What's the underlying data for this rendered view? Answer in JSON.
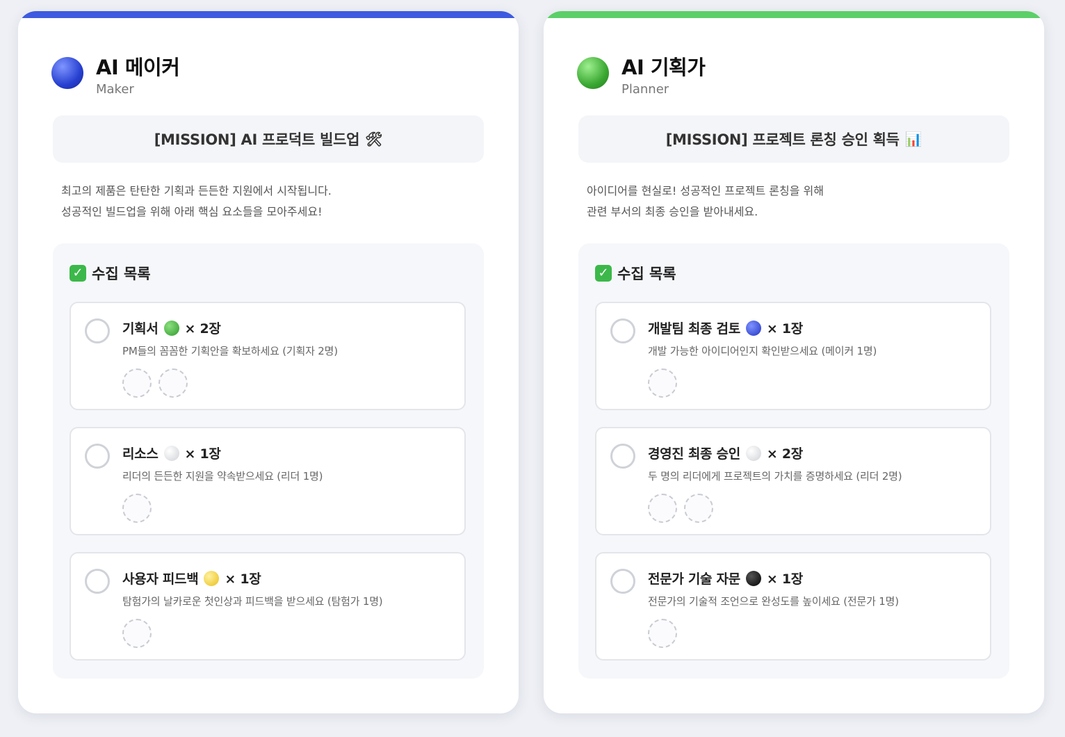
{
  "cards": [
    {
      "accent": "#3d5ae0",
      "orb_color": "#2740d0",
      "title": "AI 메이커",
      "subtitle": "Maker",
      "mission": "[MISSION] AI 프로덕트 빌드업",
      "mission_icon": "hammer-wrench-icon",
      "mission_glyph": "🛠",
      "desc_line1": "최고의 제품은 탄탄한 기획과 든든한 지원에서 시작됩니다.",
      "desc_line2": "성공적인 빌드업을 위해 아래 핵심 요소들을 모아주세요!",
      "collect_title": "수집 목록",
      "items": [
        {
          "name": "기획서",
          "dot": "green",
          "count": "× 2장",
          "desc": "PM들의 꼼꼼한 기획안을 확보하세요 (기획자 2명)",
          "slots": 2
        },
        {
          "name": "리소스",
          "dot": "white",
          "count": "× 1장",
          "desc": "리더의 든든한 지원을 약속받으세요 (리더 1명)",
          "slots": 1
        },
        {
          "name": "사용자 피드백",
          "dot": "yellow",
          "count": "× 1장",
          "desc": "탐험가의 날카로운 첫인상과 피드백을 받으세요 (탐험가 1명)",
          "slots": 1
        }
      ]
    },
    {
      "accent": "#5ccf68",
      "orb_color": "#3aa832",
      "title": "AI 기획가",
      "subtitle": "Planner",
      "mission": "[MISSION] 프로젝트 론칭 승인 획득",
      "mission_icon": "bar-chart-icon",
      "mission_glyph": "📊",
      "desc_line1": "아이디어를 현실로! 성공적인 프로젝트 론칭을 위해",
      "desc_line2": "관련 부서의 최종 승인을 받아내세요.",
      "collect_title": "수집 목록",
      "items": [
        {
          "name": "개발팀 최종 검토",
          "dot": "blue",
          "count": "× 1장",
          "desc": "개발 가능한 아이디어인지 확인받으세요 (메이커 1명)",
          "slots": 1
        },
        {
          "name": "경영진 최종 승인",
          "dot": "white",
          "count": "× 2장",
          "desc": "두 명의 리더에게 프로젝트의 가치를 증명하세요 (리더 2명)",
          "slots": 2
        },
        {
          "name": "전문가 기술 자문",
          "dot": "black",
          "count": "× 1장",
          "desc": "전문가의 기술적 조언으로 완성도를 높이세요 (전문가 1명)",
          "slots": 1
        }
      ]
    }
  ]
}
